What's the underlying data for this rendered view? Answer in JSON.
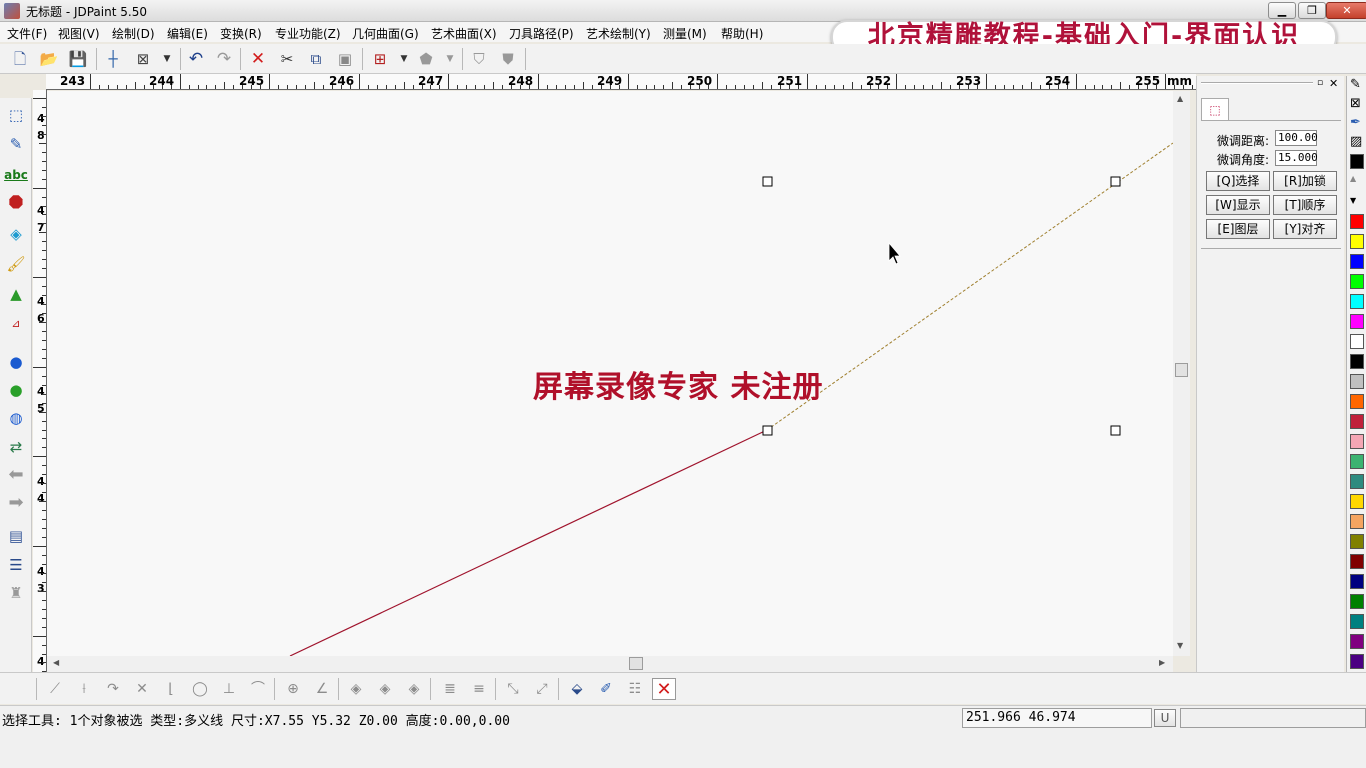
{
  "window": {
    "title": "无标题 - JDPaint 5.50",
    "min_icon": "minimize-icon",
    "max_icon": "restore-icon",
    "close_icon": "close-icon"
  },
  "menu": [
    "文件(F)",
    "视图(V)",
    "绘制(D)",
    "编辑(E)",
    "变换(R)",
    "专业功能(Z)",
    "几何曲面(G)",
    "艺术曲面(X)",
    "刀具路径(P)",
    "艺术绘制(Y)",
    "测量(M)",
    "帮助(H)"
  ],
  "promo_banner": "北京精雕教程-基础入门-界面认识",
  "toolbar": {
    "icons": [
      "new-file-icon",
      "open-folder-icon",
      "save-icon",
      "crosshair-icon",
      "zoom-box-icon",
      "dropdown-arrow-icon",
      "undo-icon",
      "redo-icon",
      "delete-icon",
      "cut-icon",
      "copy-icon",
      "paste-icon",
      "snap-grid-icon",
      "dropdown-arrow-icon",
      "render-shape-icon",
      "dropdown-arrow-icon",
      "shield-tool-icon",
      "shield-fill-icon"
    ]
  },
  "ruler": {
    "labels": [
      "243",
      "244",
      "245",
      "246",
      "247",
      "248",
      "249",
      "250",
      "251",
      "252",
      "253",
      "254",
      "255"
    ],
    "unit": "mm",
    "vertical_labels": [
      "4",
      "8",
      "4",
      "7",
      "4",
      "6",
      "4",
      "5",
      "4",
      "4",
      "4",
      "3",
      "4"
    ]
  },
  "left_tools": [
    "node-edit-icon",
    "pen-line-icon",
    "text-abc-icon",
    "polygon-icon",
    "eraser-icon",
    "paint-brush-icon",
    "fill-shape-icon",
    "dimension-icon",
    "bulb-blue-icon",
    "bulb-green-icon",
    "bulb-dual-icon",
    "transform-icon",
    "arrow-left-icon",
    "arrow-right-icon",
    "layers-icon",
    "list-lines-icon",
    "bell-icon"
  ],
  "canvas": {
    "watermark": "屏幕录像专家  未注册",
    "selection_handles": "handle-icon"
  },
  "panel": {
    "tab_icon": "select-tab-icon",
    "fine_distance_label": "微调距离:",
    "fine_distance_value": "100.00",
    "fine_angle_label": "微调角度:",
    "fine_angle_value": "15.000",
    "buttons": [
      "[Q]选择",
      "[R]加锁",
      "[W]显示",
      "[T]顺序",
      "[E]图层",
      "[Y]对齐"
    ]
  },
  "palette": {
    "tools": [
      "pen-icon",
      "no-fill-icon",
      "eyedropper-icon",
      "pattern-icon"
    ],
    "colors": [
      "#000000",
      "#ff0000",
      "#ffff00",
      "#0000ff",
      "#00ff00",
      "#00ffff",
      "#ff00ff",
      "#ffffff",
      "#000000",
      "#c0c0c0",
      "#ff6600",
      "#c0203a",
      "#f4a6b4",
      "#3cb371",
      "#2e8b7f",
      "#ffd700",
      "#f4a460",
      "#808000",
      "#800000",
      "#000080",
      "#008000",
      "#008080",
      "#800080",
      "#4b0082"
    ]
  },
  "bottom_tools": [
    "line-icon",
    "line-tangent-icon",
    "line-angle-icon",
    "cross-lines-icon",
    "corner-icon",
    "circle-icon",
    "perpendicular-icon",
    "arc-icon",
    "snap-point-icon",
    "angle-icon",
    "diamond-icon",
    "diamond-icon",
    "diamond-icon",
    "hatch-icon",
    "hatch2-icon",
    "node-icon",
    "node2-icon",
    "3d-view-icon",
    "measure-icon",
    "list-icon",
    "close-x-icon"
  ],
  "status": {
    "text": "选择工具: 1个对象被选 类型:多义线 尺寸:X7.55 Y5.32 Z0.00 高度:0.00,0.00",
    "coords": "251.966 46.974",
    "u_label": "U"
  }
}
